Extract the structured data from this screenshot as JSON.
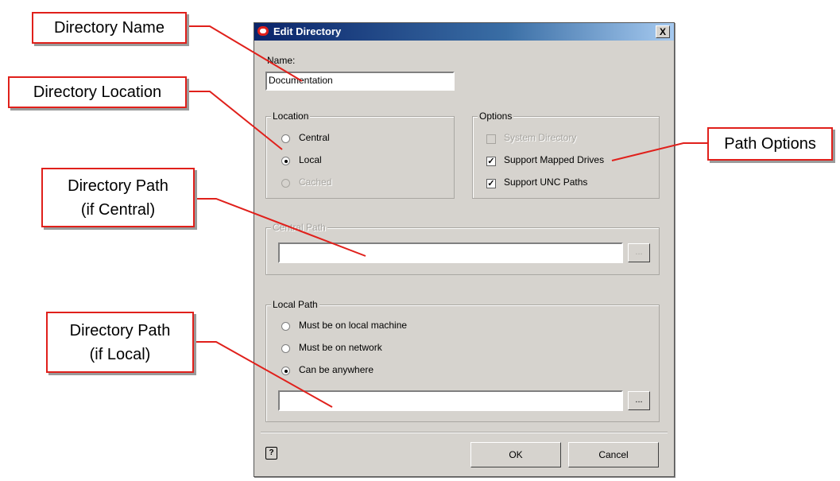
{
  "dialog": {
    "title": "Edit Directory",
    "close_label": "X",
    "name_label": "Name:",
    "name_value": "Documentation",
    "location": {
      "title": "Location",
      "options": [
        "Central",
        "Local",
        "Cached"
      ],
      "selected": "Local"
    },
    "options_group": {
      "title": "Options",
      "items": [
        {
          "label": "System Directory",
          "checked": false,
          "disabled": true
        },
        {
          "label": "Support Mapped Drives",
          "checked": true,
          "disabled": false
        },
        {
          "label": "Support UNC Paths",
          "checked": true,
          "disabled": false
        }
      ]
    },
    "central_path": {
      "title": "Central Path",
      "value": "",
      "browse_label": "..."
    },
    "local_path": {
      "title": "Local Path",
      "options": [
        "Must be on local machine",
        "Must be on network",
        "Can be anywhere"
      ],
      "selected": "Can be anywhere",
      "value": "",
      "browse_label": "..."
    },
    "help_label": "?",
    "ok_label": "OK",
    "cancel_label": "Cancel"
  },
  "callouts": {
    "directory_name": "Directory Name",
    "directory_location": "Directory Location",
    "path_central_line1": "Directory Path",
    "path_central_line2": "(if Central)",
    "path_local_line1": "Directory Path",
    "path_local_line2": "(if Local)",
    "path_options": "Path Options"
  },
  "colors": {
    "callout_border": "#e0201b",
    "dialog_bg": "#d6d3ce",
    "titlebar": "#0a246a"
  }
}
